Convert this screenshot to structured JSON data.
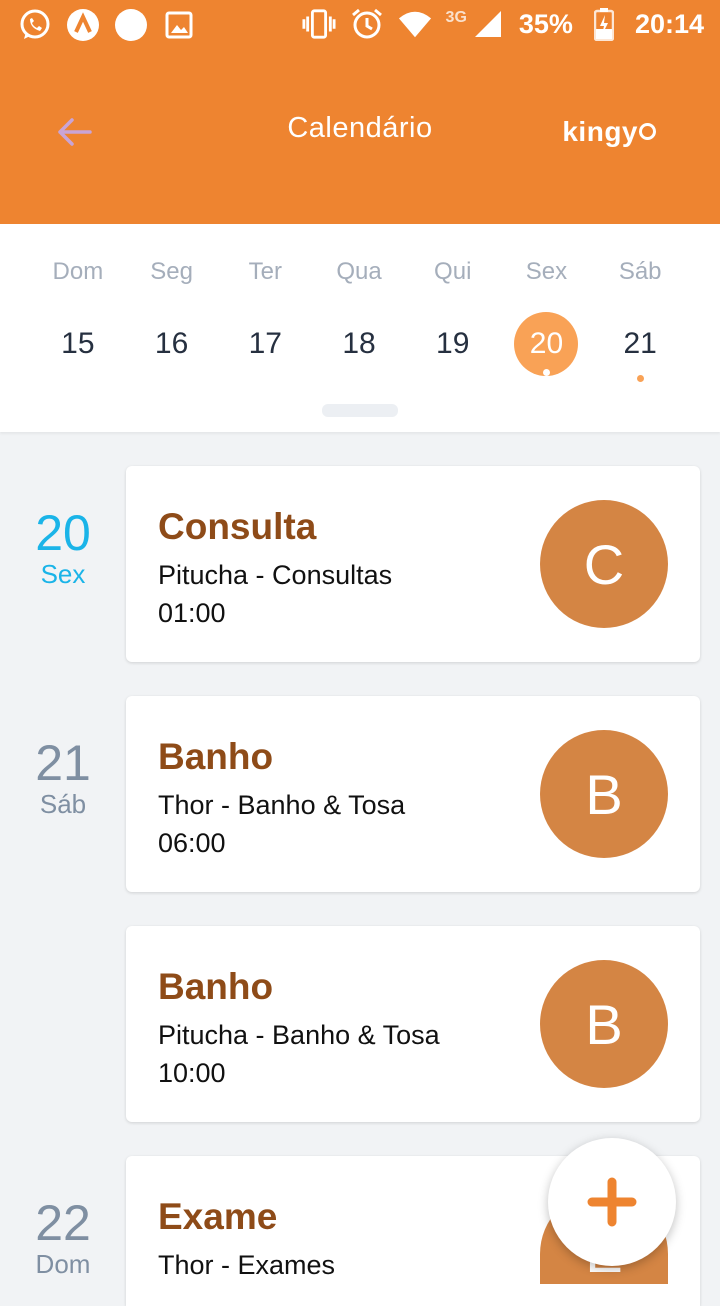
{
  "status_bar": {
    "battery": "35%",
    "time": "20:14",
    "network": "3G",
    "left_icons": [
      "whatsapp-icon",
      "app-icon",
      "circle-icon",
      "image-icon"
    ],
    "right_icons": [
      "vibrate-icon",
      "alarm-icon",
      "wifi-icon",
      "signal-icon",
      "battery-charging-icon"
    ]
  },
  "header": {
    "title": "Calendário",
    "brand": "kingy",
    "back_icon": "arrow-left-icon",
    "colors": {
      "background": "#ee8430",
      "back_arrow": "#c9a4d6"
    }
  },
  "week": {
    "day_names": [
      "Dom",
      "Seg",
      "Ter",
      "Qua",
      "Qui",
      "Sex",
      "Sáb"
    ],
    "days": [
      {
        "num": "15",
        "selected": false,
        "has_event": false
      },
      {
        "num": "16",
        "selected": false,
        "has_event": false
      },
      {
        "num": "17",
        "selected": false,
        "has_event": false
      },
      {
        "num": "18",
        "selected": false,
        "has_event": false
      },
      {
        "num": "19",
        "selected": false,
        "has_event": false
      },
      {
        "num": "20",
        "selected": true,
        "has_event": true
      },
      {
        "num": "21",
        "selected": false,
        "has_event": true
      }
    ],
    "colors": {
      "selected": "#f9a256",
      "day_name": "#a5aebb"
    }
  },
  "agenda": {
    "groups": [
      {
        "date_num": "20",
        "weekday": "Sex",
        "today": true
      },
      {
        "date_num": "21",
        "weekday": "Sáb",
        "today": false
      },
      {
        "date_num": "22",
        "weekday": "Dom",
        "today": false
      }
    ],
    "events": [
      {
        "title": "Consulta",
        "subtitle": "Pitucha - Consultas",
        "time": "01:00",
        "initial": "C"
      },
      {
        "title": "Banho",
        "subtitle": "Thor - Banho & Tosa",
        "time": "06:00",
        "initial": "B"
      },
      {
        "title": "Banho",
        "subtitle": "Pitucha - Banho & Tosa",
        "time": "10:00",
        "initial": "B"
      },
      {
        "title": "Exame",
        "subtitle": "Thor - Exames",
        "time": "",
        "initial": "E"
      }
    ],
    "colors": {
      "title": "#8e4b18",
      "avatar": "#d48544",
      "today_date": "#1ab4e8",
      "date": "#7f8fa2"
    }
  },
  "fab": {
    "icon": "plus-icon",
    "color": "#ee8430"
  }
}
